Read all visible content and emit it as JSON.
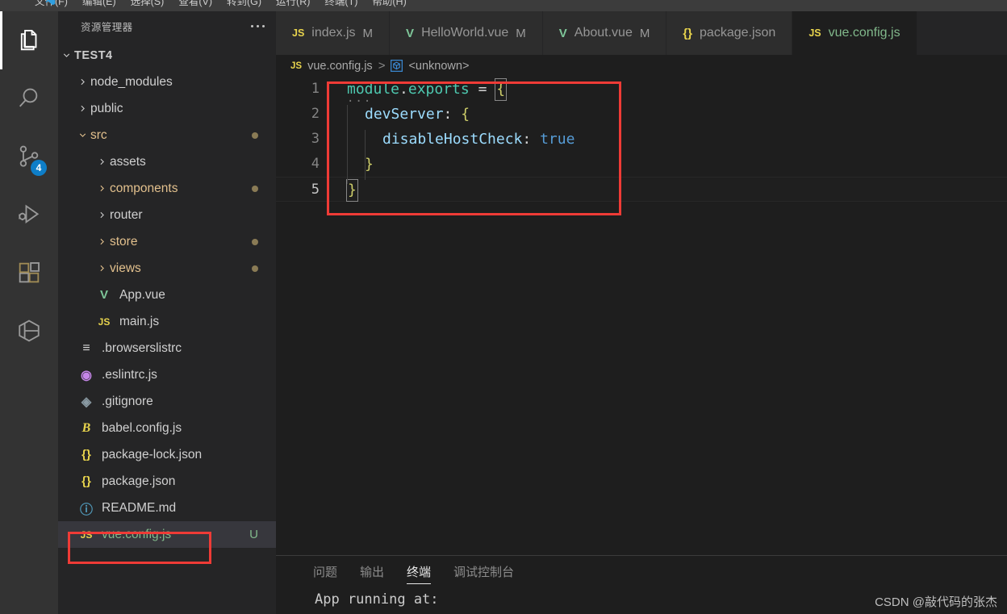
{
  "window": {
    "menu_items": [
      "文件(F)",
      "编辑(E)",
      "选择(S)",
      "查看(V)",
      "转到(G)",
      "运行(R)",
      "终端(T)",
      "帮助(H)"
    ]
  },
  "activity_bar": {
    "items": [
      {
        "name": "explorer",
        "icon": "files-icon",
        "active": true,
        "badge": ""
      },
      {
        "name": "search",
        "icon": "search-icon",
        "active": false,
        "badge": ""
      },
      {
        "name": "source-control",
        "icon": "source-control-icon",
        "active": false,
        "badge": "4"
      },
      {
        "name": "run-and-debug",
        "icon": "run-debug-icon",
        "active": false,
        "badge": ""
      },
      {
        "name": "extensions",
        "icon": "extensions-icon",
        "active": false,
        "badge": ""
      },
      {
        "name": "remote-explorer",
        "icon": "cube-icon",
        "active": false,
        "badge": ""
      }
    ]
  },
  "sidebar": {
    "header_title": "资源管理器",
    "more_actions": "...",
    "root": {
      "label": "TEST4",
      "expanded": true
    },
    "tree": [
      {
        "label": "node_modules",
        "kind": "folder",
        "indent": 0,
        "expanded": false,
        "color": "#d0d0d0",
        "dot": false,
        "git": ""
      },
      {
        "label": "public",
        "kind": "folder",
        "indent": 0,
        "expanded": false,
        "color": "#d0d0d0",
        "dot": false,
        "git": ""
      },
      {
        "label": "src",
        "kind": "folder",
        "indent": 0,
        "expanded": true,
        "color": "#e2c08d",
        "dot": true,
        "git": ""
      },
      {
        "label": "assets",
        "kind": "folder",
        "indent": 1,
        "expanded": false,
        "color": "#d0d0d0",
        "dot": false,
        "git": ""
      },
      {
        "label": "components",
        "kind": "folder",
        "indent": 1,
        "expanded": false,
        "color": "#e2c08d",
        "dot": true,
        "git": ""
      },
      {
        "label": "router",
        "kind": "folder",
        "indent": 1,
        "expanded": false,
        "color": "#d0d0d0",
        "dot": false,
        "git": ""
      },
      {
        "label": "store",
        "kind": "folder",
        "indent": 1,
        "expanded": false,
        "color": "#e2c08d",
        "dot": true,
        "git": ""
      },
      {
        "label": "views",
        "kind": "folder",
        "indent": 1,
        "expanded": false,
        "color": "#e2c08d",
        "dot": true,
        "git": ""
      },
      {
        "label": "App.vue",
        "kind": "file",
        "icon": "vue-icon",
        "icon_text": "V",
        "icon_color": "#7ec699",
        "indent": 1,
        "color": "#d0d0d0",
        "dot": false,
        "git": ""
      },
      {
        "label": "main.js",
        "kind": "file",
        "icon": "js-icon",
        "icon_text": "JS",
        "icon_color": "#e8d44d",
        "indent": 1,
        "color": "#d0d0d0",
        "dot": false,
        "git": ""
      },
      {
        "label": ".browserslistrc",
        "kind": "file",
        "icon": "list-icon",
        "icon_text": "≡",
        "icon_color": "#d4d4d4",
        "indent": 0,
        "color": "#d0d0d0",
        "dot": false,
        "git": ""
      },
      {
        "label": ".eslintrc.js",
        "kind": "file",
        "icon": "eslint-icon",
        "icon_text": "◉",
        "icon_color": "#c586e8",
        "indent": 0,
        "color": "#d0d0d0",
        "dot": false,
        "git": ""
      },
      {
        "label": ".gitignore",
        "kind": "file",
        "icon": "git-icon",
        "icon_text": "◈",
        "icon_color": "#8a9aa3",
        "indent": 0,
        "color": "#d0d0d0",
        "dot": false,
        "git": ""
      },
      {
        "label": "babel.config.js",
        "kind": "file",
        "icon": "babel-icon",
        "icon_text": "B",
        "icon_color": "#e8d44d",
        "indent": 0,
        "color": "#d0d0d0",
        "dot": false,
        "git": ""
      },
      {
        "label": "package-lock.json",
        "kind": "file",
        "icon": "json-icon",
        "icon_text": "{}",
        "icon_color": "#e8d44d",
        "indent": 0,
        "color": "#d0d0d0",
        "dot": false,
        "git": ""
      },
      {
        "label": "package.json",
        "kind": "file",
        "icon": "json-icon",
        "icon_text": "{}",
        "icon_color": "#e8d44d",
        "indent": 0,
        "color": "#d0d0d0",
        "dot": false,
        "git": ""
      },
      {
        "label": "README.md",
        "kind": "file",
        "icon": "info-icon",
        "icon_text": "ⓘ",
        "icon_color": "#519aba",
        "indent": 0,
        "color": "#d0d0d0",
        "dot": false,
        "git": ""
      },
      {
        "label": "vue.config.js",
        "kind": "file",
        "icon": "js-icon",
        "icon_text": "JS",
        "icon_color": "#e8d44d",
        "indent": 0,
        "color": "#81b88b",
        "dot": false,
        "git": "U",
        "selected": true,
        "annotated": true
      }
    ]
  },
  "editor": {
    "tabs": [
      {
        "label": "index.js",
        "icon_text": "JS",
        "icon_color": "#e8d44d",
        "flag": "M",
        "active": false
      },
      {
        "label": "HelloWorld.vue",
        "icon_text": "V",
        "icon_color": "#7ec699",
        "flag": "M",
        "active": false
      },
      {
        "label": "About.vue",
        "icon_text": "V",
        "icon_color": "#7ec699",
        "flag": "M",
        "active": false
      },
      {
        "label": "package.json",
        "icon_text": "{}",
        "icon_color": "#e8d44d",
        "flag": "",
        "active": false
      },
      {
        "label": "vue.config.js",
        "icon_text": "JS",
        "icon_color": "#e8d44d",
        "flag": "",
        "active": true
      }
    ],
    "breadcrumb": {
      "file_icon_text": "JS",
      "file": "vue.config.js",
      "separator": ">",
      "symbol_icon": "module-icon",
      "symbol": "<unknown>"
    },
    "lines": [
      {
        "num": "1",
        "current": false
      },
      {
        "num": "2",
        "current": false
      },
      {
        "num": "3",
        "current": false
      },
      {
        "num": "4",
        "current": false
      },
      {
        "num": "5",
        "current": true
      }
    ],
    "code_tokens": {
      "l1_module": "module",
      "l1_dot": ".",
      "l1_exports": "exports",
      "l1_eq": " = ",
      "l1_brace": "{",
      "l2_key": "devServer",
      "l2_colon": ": ",
      "l2_brace": "{",
      "l3_key": "disableHostCheck",
      "l3_colon": ": ",
      "l3_value": "true",
      "l4_brace": "}",
      "l5_brace": "}"
    },
    "fold_marker": "···"
  },
  "panel": {
    "tabs": [
      {
        "label": "问题",
        "active": false
      },
      {
        "label": "输出",
        "active": false
      },
      {
        "label": "终端",
        "active": true
      },
      {
        "label": "调试控制台",
        "active": false
      }
    ],
    "terminal_text": "App running at:"
  },
  "watermark": "CSDN @敲代码的张杰",
  "colors": {
    "accent_blue": "#0e7ec8",
    "annotation_red": "#ef3b36",
    "git_added_green": "#81b88b",
    "git_modified_amber": "#e2c08d",
    "editor_bg": "#1e1e1e",
    "sidebar_bg": "#252526",
    "activitybar_bg": "#333333"
  }
}
